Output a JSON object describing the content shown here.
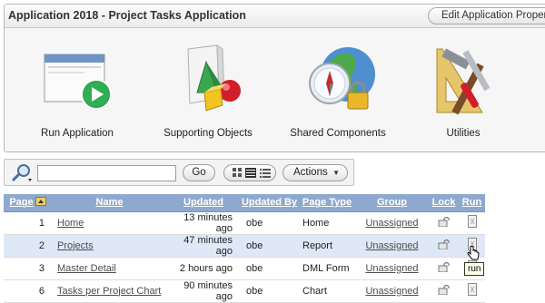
{
  "app": {
    "title": "Application 2018 - Project Tasks Application",
    "edit_button": "Edit Application Properties"
  },
  "tiles": [
    {
      "label": "Run Application",
      "icon": "run-application-icon"
    },
    {
      "label": "Supporting Objects",
      "icon": "supporting-objects-icon"
    },
    {
      "label": "Shared Components",
      "icon": "shared-components-icon"
    },
    {
      "label": "Utilities",
      "icon": "utilities-icon"
    }
  ],
  "toolbar": {
    "search_value": "",
    "go_label": "Go",
    "actions_label": "Actions",
    "view_modes": [
      "icons-view-icon",
      "report-view-icon",
      "details-view-icon"
    ],
    "selected_view": "report-view-icon"
  },
  "table": {
    "columns": [
      "Page",
      "Name",
      "Updated",
      "Updated By",
      "Page Type",
      "Group",
      "Lock",
      "Run"
    ],
    "sort_column": "Page",
    "sort_direction": "ascending",
    "rows": [
      {
        "page": "1",
        "name": "Home",
        "updated": "13 minutes ago",
        "by": "obe",
        "type": "Home",
        "group": "Unassigned"
      },
      {
        "page": "2",
        "name": "Projects",
        "updated": "47 minutes ago",
        "by": "obe",
        "type": "Report",
        "group": "Unassigned"
      },
      {
        "page": "3",
        "name": "Master Detail",
        "updated": "2 hours ago",
        "by": "obe",
        "type": "DML Form",
        "group": "Unassigned"
      },
      {
        "page": "6",
        "name": "Tasks per Project Chart",
        "updated": "90 minutes ago",
        "by": "obe",
        "type": "Chart",
        "group": "Unassigned"
      }
    ],
    "highlighted_row": 1
  },
  "tooltip": "run",
  "colors": {
    "header_bg": "#8ea9cf",
    "selected_row": "#dfe8f7",
    "run_green": "#27a04a"
  }
}
